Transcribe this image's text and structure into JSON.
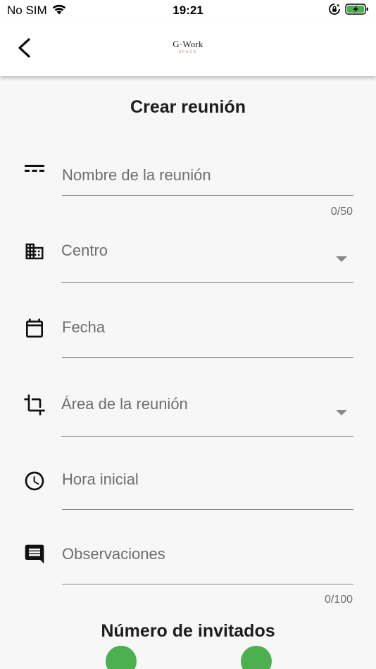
{
  "status_bar": {
    "carrier": "No SIM",
    "time": "19:21",
    "battery_color": "#4caf50"
  },
  "app_bar": {
    "back_icon": "chevron-left-icon",
    "logo_text": "G·Work",
    "logo_subtext": "SPACE"
  },
  "form": {
    "title": "Crear reunión",
    "fields": [
      {
        "name": "meeting-name",
        "icon": "short-text-icon",
        "placeholder": "Nombre de la reunión",
        "counter": "0/50"
      },
      {
        "name": "center",
        "icon": "building-icon",
        "placeholder": "Centro",
        "dropdown": true
      },
      {
        "name": "date",
        "icon": "calendar-icon",
        "placeholder": "Fecha"
      },
      {
        "name": "meeting-area",
        "icon": "crop-icon",
        "placeholder": "Área de la reunión",
        "dropdown": true
      },
      {
        "name": "start-time",
        "icon": "clock-icon",
        "placeholder": "Hora inicial"
      },
      {
        "name": "observations",
        "icon": "comment-icon",
        "placeholder": "Observaciones",
        "counter": "0/100"
      }
    ],
    "guests_title": "Número de invitados"
  },
  "colors": {
    "accent_green": "#4caf50",
    "underline": "#8a8a8a",
    "placeholder_text": "#6e6e6e"
  }
}
